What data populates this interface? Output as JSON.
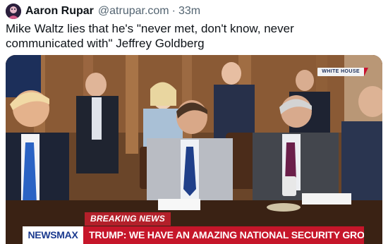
{
  "post": {
    "author_name": "Aaron Rupar",
    "author_handle": "@atrupar.com",
    "separator": "·",
    "time": "33m",
    "text": "Mike Waltz lies that he's \"never met, don't know, never\ncommunicated with\" Jeffrey Goldberg"
  },
  "media": {
    "watermark": "WHITE HOUSE",
    "breaking_label": "BREAKING NEWS",
    "network_logo": "NEWSMAX",
    "headline": "TRUMP: WE HAVE AN AMAZING NATIONAL SECURITY GROUP"
  },
  "colors": {
    "breaking_red": "#b3202a",
    "headline_red": "#c6162a",
    "network_blue": "#1b3a8f",
    "handle_gray": "#536471"
  },
  "icons": {
    "avatar": "user-avatar"
  }
}
